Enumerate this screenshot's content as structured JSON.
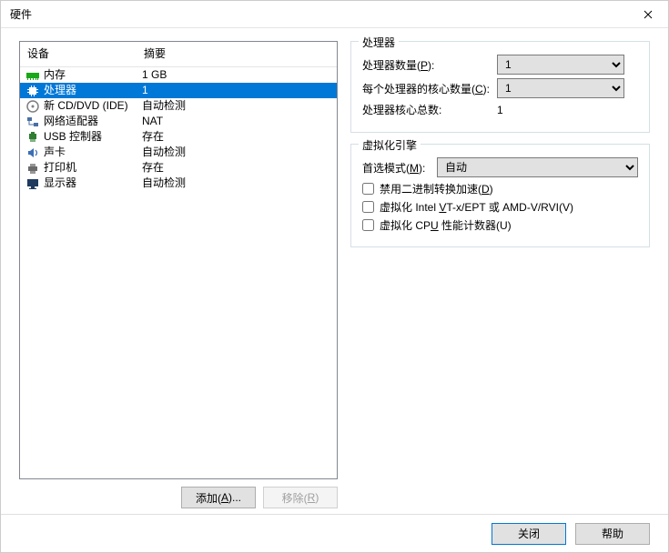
{
  "window": {
    "title": "硬件",
    "close": "✕"
  },
  "left": {
    "header_device": "设备",
    "header_summary": "摘要",
    "devices": [
      {
        "name": "内存",
        "summary": "1 GB",
        "icon": "memory-icon",
        "selected": false
      },
      {
        "name": "处理器",
        "summary": "1",
        "icon": "cpu-icon",
        "selected": true
      },
      {
        "name": "新 CD/DVD (IDE)",
        "summary": "自动检测",
        "icon": "disc-icon",
        "selected": false
      },
      {
        "name": "网络适配器",
        "summary": "NAT",
        "icon": "network-icon",
        "selected": false
      },
      {
        "name": "USB 控制器",
        "summary": "存在",
        "icon": "usb-icon",
        "selected": false
      },
      {
        "name": "声卡",
        "summary": "自动检测",
        "icon": "sound-icon",
        "selected": false
      },
      {
        "name": "打印机",
        "summary": "存在",
        "icon": "printer-icon",
        "selected": false
      },
      {
        "name": "显示器",
        "summary": "自动检测",
        "icon": "display-icon",
        "selected": false
      }
    ],
    "add_button": "添加(A)...",
    "add_hotkey": "A",
    "remove_button": "移除(R)",
    "remove_hotkey": "R"
  },
  "processors": {
    "legend": "处理器",
    "num_processors_label": "处理器数量(P):",
    "np_hotkey": "P",
    "num_processors_value": "1",
    "cores_per_label": "每个处理器的核心数量(C):",
    "cp_hotkey": "C",
    "cores_per_value": "1",
    "total_cores_label": "处理器核心总数:",
    "total_cores_value": "1"
  },
  "virtualization": {
    "legend": "虚拟化引擎",
    "preferred_mode_label": "首选模式(M):",
    "pm_hotkey": "M",
    "preferred_mode_value": "自动",
    "cb_disable_binary": "禁用二进制转换加速(D)",
    "cb1_hotkey": "D",
    "cb_vt_x": "虚拟化 Intel VT-x/EPT 或 AMD-V/RVI(V)",
    "cb2_hotkey": "V",
    "cb_perf_counters": "虚拟化 CPU 性能计数器(U)",
    "cb3_hotkey": "U"
  },
  "footer": {
    "close": "关闭",
    "help": "帮助"
  },
  "icons": {
    "memory-icon": "#18a818",
    "cpu-icon": "#1e5fb4",
    "disc-icon": "#7f7f7f",
    "network-icon": "#4a6fa5",
    "usb-icon": "#2f7d32",
    "sound-icon": "#3b6fb5",
    "printer-icon": "#6b6b6b",
    "display-icon": "#1e3a5f"
  }
}
